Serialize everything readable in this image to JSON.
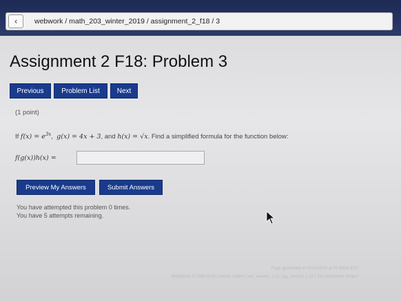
{
  "breadcrumb": {
    "back_icon": "chevron-left-icon",
    "path": "webwork / math_203_winter_2019 / assignment_2_f18 / 3"
  },
  "page": {
    "title": "Assignment 2 F18: Problem 3"
  },
  "nav": {
    "previous": "Previous",
    "problem_list": "Problem List",
    "next": "Next"
  },
  "problem": {
    "points": "(1 point)",
    "if_label": "If",
    "f_def": "f(x) = e",
    "f_exp": "3x",
    "g_def": "g(x) = 4x + 3",
    "and_label": "and",
    "h_def": "h(x) = √x",
    "instruction": "Find a simplified formula for the function below:",
    "answer_label": "f(g(x))h(x) =",
    "answer_value": ""
  },
  "actions": {
    "preview": "Preview My Answers",
    "submit": "Submit Answers"
  },
  "status": {
    "attempted": "You have attempted this problem 0 times.",
    "remaining": "You have 5 attempts remaining."
  },
  "footer": {
    "line1": "Page generated at 02/01/2019 at 05:59pm EST",
    "line2": "WeBWorK © 1996-2016 | theme: math4 | ww_version: 2.12 | pg_version: 2.12 | The WeBWorK Project"
  },
  "colors": {
    "button_bg": "#1a3b8d",
    "title_bar": "#1d2a55"
  }
}
